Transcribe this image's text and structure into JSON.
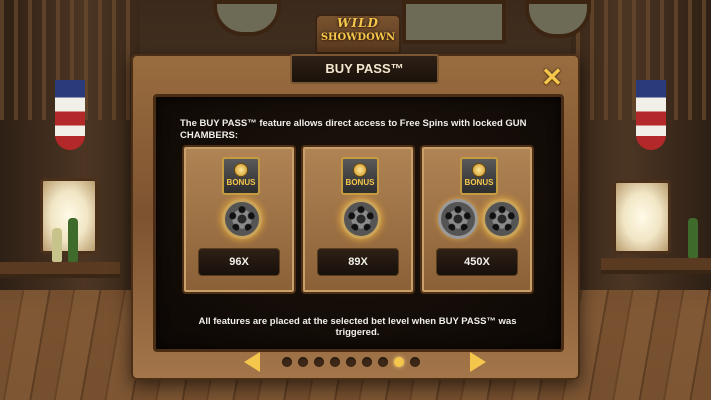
{
  "game": {
    "logo_line1": "WILD",
    "logo_line2": "SHOWDOWN"
  },
  "dialog": {
    "title": "BUY PASS™",
    "description": "The BUY PASS™ feature allows direct access to Free Spins with locked GUN CHAMBERS:",
    "footnote": "All features are placed at the selected bet level when BUY PASS™ was triggered.",
    "close_icon": "close-x-icon"
  },
  "options": [
    {
      "bonus_label": "BONUS",
      "locked_chambers": 1,
      "price": "96X"
    },
    {
      "bonus_label": "BONUS",
      "locked_chambers": 1,
      "price": "89X"
    },
    {
      "bonus_label": "BONUS",
      "locked_chambers": 2,
      "price": "450X"
    }
  ],
  "pagination": {
    "total_pages": 9,
    "current_page": 8
  },
  "colors": {
    "accent_gold": "#f5c64c",
    "panel_wood": "#8a6037",
    "text": "#f1efe9"
  }
}
